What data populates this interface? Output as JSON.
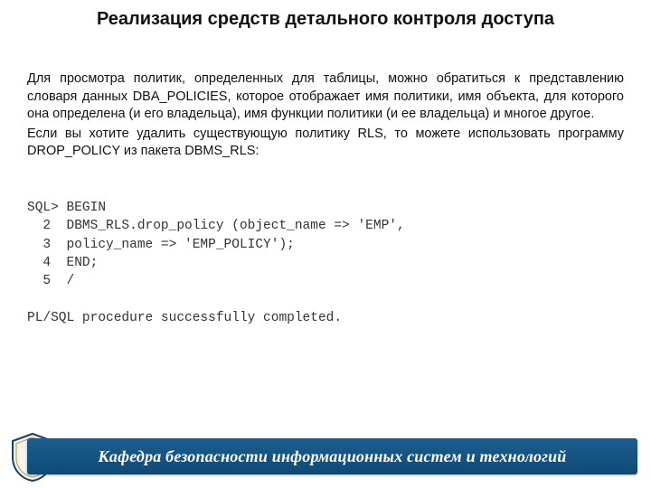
{
  "title": "Реализация средств детального контроля доступа",
  "paragraphs": {
    "p1": "Для просмотра политик, определенных для таблицы, можно обратиться к представлению словаря данных DBA_POLICIES, которое отображает имя политики, имя объекта, для которого она определена (и его владельца), имя функции политики (и ее владельца) и многое другое.",
    "p2": "Если вы хотите удалить существующую политику RLS, то можете использовать программу DROP_POLICY из пакета DBMS_RLS:"
  },
  "code": "SQL> BEGIN\n  2  DBMS_RLS.drop_policy (object_name => 'EMP',\n  3  policy_name => 'EMP_POLICY');\n  4  END;\n  5  /\n\nPL/SQL procedure successfully completed.",
  "footer": "Кафедра безопасности информационных систем и технологий"
}
